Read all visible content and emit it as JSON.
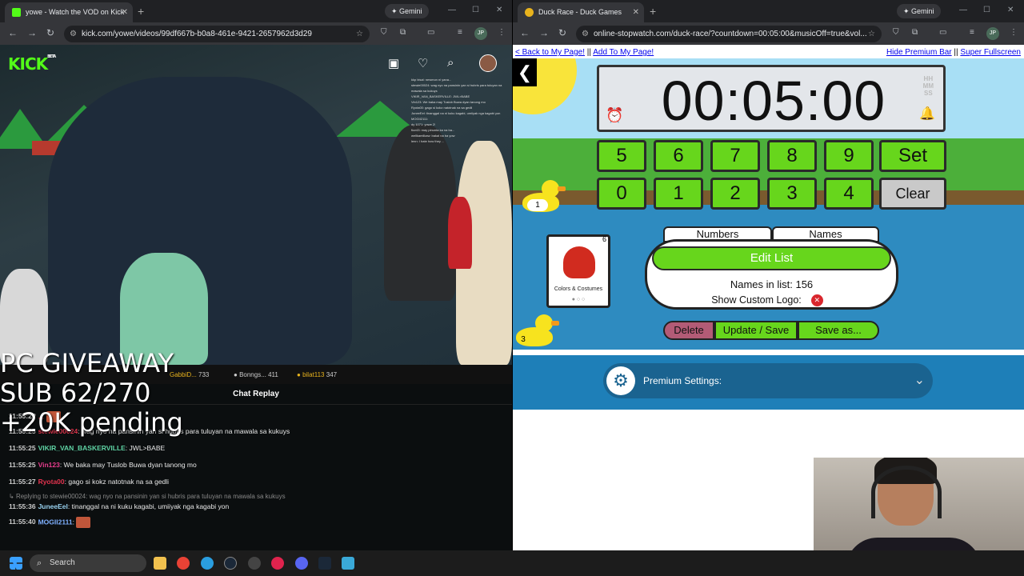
{
  "left_browser": {
    "tab_title": "yowe - Watch the VOD on Kick",
    "gemini": "Gemini",
    "url": "kick.com/yowe/videos/99df667b-b0a8-461e-9421-2657962d3d29",
    "profile": "JP"
  },
  "kick": {
    "logo": "KICK",
    "logo_badge": "BETA",
    "overlay_chat": [
      "kkp bisal: newmon ni yana...",
      "stewie00024: wag nyo na pansinin yan si hubris para tuluyan na mawala sa kukuys",
      "VIKIR_VAN_BASKERVILLE: JWL>BABE",
      "Vin123: We baka may Tuslob Buwa dyan tanong mo",
      "Ryota00: gago si kokz natotnak na sa gedli",
      "JuneeEel: tinanggal na ni kuku kagabi, umiiyak nga kagabi yon",
      "MOGII2111:",
      "dy 1071: yowe 2!",
      "fizz43: may pinunta ka na ba...",
      "wellkamilkaw: bakal na ba yow",
      "lenn: I hate how they ..."
    ],
    "gifters": [
      {
        "name": "GabbiD...",
        "count": "733"
      },
      {
        "name": "Bonngs...",
        "count": "411"
      },
      {
        "name": "bilat113",
        "count": "347"
      }
    ],
    "chat_header": "Chat Replay",
    "overlay_giveaway": [
      "PC GIVEAWAY",
      "SUB 62/270",
      "+20K pending"
    ],
    "messages": [
      {
        "time": "11:55:2?",
        "user": "...",
        "color": "#e23a4b",
        "text": ""
      },
      {
        "time": "11:55:25",
        "user": "stewie00024",
        "color": "#d9344a",
        "text": ": wag nyo na pansinin yan si hubris para tuluyan na mawala sa kukuys"
      },
      {
        "time": "11:55:25",
        "user": "VIKIR_VAN_BASKERVILLE",
        "color": "#5fd3a4",
        "text": ": JWL>BABE"
      },
      {
        "time": "11:55:25",
        "user": "Vin123",
        "color": "#e83d8d",
        "text": ": We baka may Tuslob Buwa dyan tanong mo"
      },
      {
        "time": "11:55:27",
        "user": "Ryota00",
        "color": "#e2334e",
        "text": ": gago si kokz natotnak na sa gedli"
      },
      {
        "time": "11:55:36",
        "user": "JuneeEel",
        "color": "#9ad3f1",
        "text": ": tinanggal na ni kuku kagabi, umiiyak nga kagabi yon"
      },
      {
        "time": "11:55:40",
        "user": "MOGII2111",
        "color": "#7fb0ff",
        "text": ":"
      }
    ],
    "reply_line": "Replying to stewie00024: wag nyo na pansinin yan si hubris para tuluyan na mawala sa kukuys"
  },
  "right_browser": {
    "tab_title": "Duck Race - Duck Games",
    "gemini": "Gemini",
    "url": "online-stopwatch.com/duck-race/?countdown=00:05:00&musicOff=true&vol...",
    "profile": "JP"
  },
  "duck_race": {
    "links_left": [
      "< Back to My Page!",
      "Add To My Page!"
    ],
    "links_right": [
      "Hide Premium Bar",
      "Super Fullscreen"
    ],
    "separator": "||",
    "timer": "00:05:00",
    "hhmmss": [
      "HH",
      "MM",
      "SS"
    ],
    "keys_row1": [
      "5",
      "6",
      "7",
      "8",
      "9",
      "Set"
    ],
    "keys_row2": [
      "0",
      "1",
      "2",
      "3",
      "4",
      "Clear"
    ],
    "duck_numbers": [
      "1",
      "3"
    ],
    "costume_label": "Colors & Costumes",
    "costume_number": "6",
    "tabs": [
      "Numbers",
      "Names"
    ],
    "edit_list": "Edit List",
    "names_count_label": "Names in list: 156",
    "custom_logo_label": "Show Custom Logo:",
    "buttons": [
      "Delete",
      "Update / Save",
      "Save as..."
    ],
    "premium_label": "Premium Settings:",
    "colors": {
      "green": "#67d61c",
      "delete": "#b35b76",
      "premium": "#1e7fb8"
    }
  },
  "taskbar": {
    "search": "Search"
  }
}
